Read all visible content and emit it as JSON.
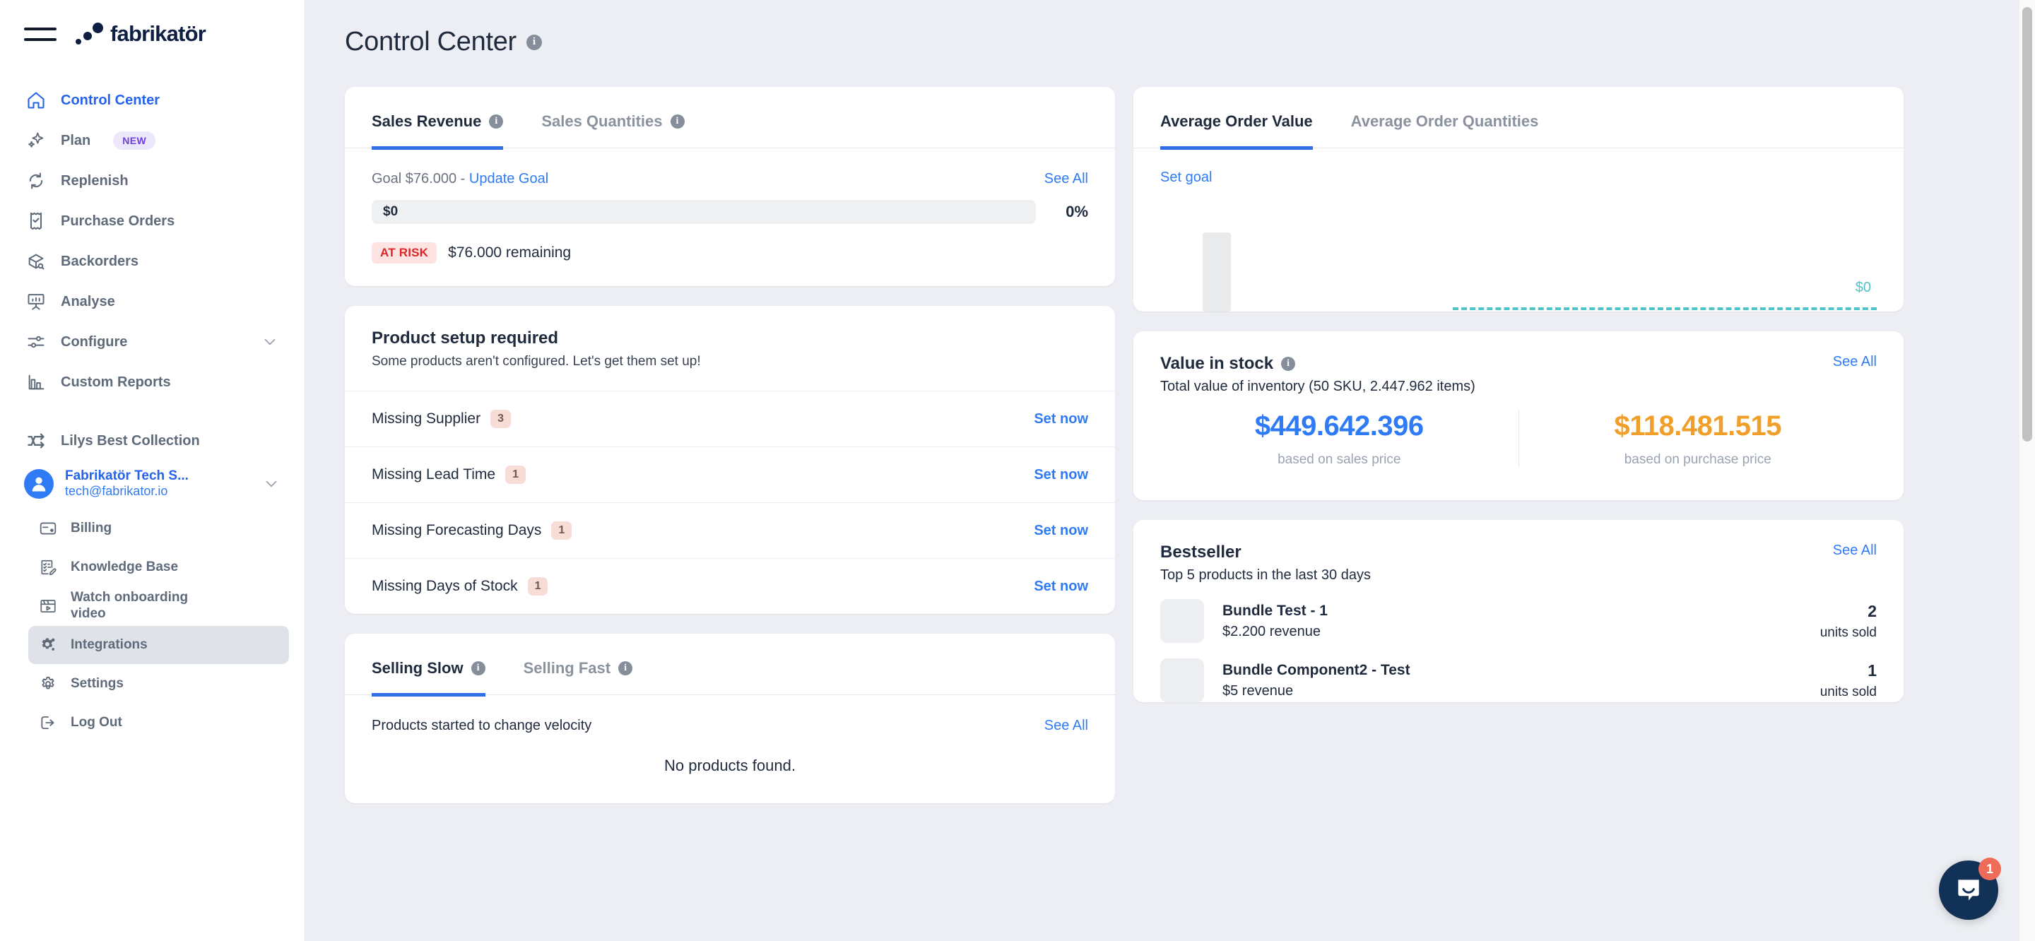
{
  "brand": {
    "name": "fabrikatör"
  },
  "sidebar": {
    "items": [
      {
        "label": "Control Center",
        "icon": "home-icon",
        "state": "active"
      },
      {
        "label": "Plan",
        "icon": "sparkle-icon",
        "badge": "NEW"
      },
      {
        "label": "Replenish",
        "icon": "refresh-icon"
      },
      {
        "label": "Purchase Orders",
        "icon": "receipt-check-icon"
      },
      {
        "label": "Backorders",
        "icon": "box-search-icon"
      },
      {
        "label": "Analyse",
        "icon": "presentation-chart-icon"
      },
      {
        "label": "Configure",
        "icon": "sliders-icon",
        "chevron": true
      },
      {
        "label": "Custom Reports",
        "icon": "bar-chart-icon"
      },
      {
        "label": "Lilys Best Collection",
        "icon": "shuffle-icon"
      }
    ],
    "account": {
      "name": "Fabrikatör Tech S...",
      "email": "tech@fabrikator.io"
    },
    "subitems": [
      {
        "label": "Billing",
        "icon": "credit-card-icon"
      },
      {
        "label": "Knowledge Base",
        "icon": "clipboard-edit-icon"
      },
      {
        "label": "Watch onboarding video",
        "icon": "video-clapper-icon"
      },
      {
        "label": "Integrations",
        "icon": "gears-icon",
        "state": "highlight"
      },
      {
        "label": "Settings",
        "icon": "gear-icon"
      },
      {
        "label": "Log Out",
        "icon": "logout-icon"
      }
    ]
  },
  "page": {
    "title": "Control Center"
  },
  "sales_card": {
    "tabs": [
      {
        "label": "Sales Revenue",
        "active": true,
        "info": true
      },
      {
        "label": "Sales Quantities",
        "active": false,
        "info": true
      }
    ],
    "goal_prefix": "Goal $76.000 - ",
    "goal_link": "Update Goal",
    "see_all": "See All",
    "progress_value": "$0",
    "progress_pct": "0%",
    "risk_badge": "AT RISK",
    "risk_text": "$76.000 remaining"
  },
  "setup_card": {
    "title": "Product setup required",
    "subtitle": "Some products aren't configured. Let's get them set up!",
    "rows": [
      {
        "label": "Missing Supplier",
        "count": "3",
        "action": "Set now"
      },
      {
        "label": "Missing Lead Time",
        "count": "1",
        "action": "Set now"
      },
      {
        "label": "Missing Forecasting Days",
        "count": "1",
        "action": "Set now"
      },
      {
        "label": "Missing Days of Stock",
        "count": "1",
        "action": "Set now"
      }
    ]
  },
  "selling_card": {
    "tabs": [
      {
        "label": "Selling Slow",
        "active": true,
        "info": true
      },
      {
        "label": "Selling Fast",
        "active": false,
        "info": true
      }
    ],
    "velocity_text": "Products started to change velocity",
    "see_all": "See All",
    "empty": "No products found."
  },
  "aov_card": {
    "tabs": [
      {
        "label": "Average Order Value",
        "active": true
      },
      {
        "label": "Average Order Quantities",
        "active": false
      }
    ],
    "set_goal": "Set goal",
    "chart_value": "$0"
  },
  "value_in_stock": {
    "title": "Value in stock",
    "subtitle": "Total value of inventory (50 SKU, 2.447.962 items)",
    "see_all": "See All",
    "stats": [
      {
        "value": "$449.642.396",
        "caption": "based on sales price",
        "color": "#2f7bf6"
      },
      {
        "value": "$118.481.515",
        "caption": "based on purchase price",
        "color": "#f0a02a"
      }
    ]
  },
  "bestseller": {
    "title": "Bestseller",
    "subtitle": "Top 5 products in the last 30 days",
    "see_all": "See All",
    "rows": [
      {
        "name": "Bundle Test - 1",
        "revenue": "$2.200 revenue",
        "units": "2",
        "units_label": "units sold"
      },
      {
        "name": "Bundle Component2 - Test",
        "revenue": "$5 revenue",
        "units": "1",
        "units_label": "units sold"
      }
    ]
  },
  "chat": {
    "unread": "1"
  },
  "chart_data": {
    "type": "bar",
    "title": "Average Order Value",
    "categories": [
      ""
    ],
    "values": [
      0
    ],
    "series": [
      {
        "name": "Average Order Value",
        "values": [
          0
        ]
      }
    ],
    "goal_line": 0,
    "goal_label": "$0",
    "xlabel": "",
    "ylabel": "",
    "ylim": [
      0,
      0
    ],
    "legend": "none",
    "grid": false,
    "annotations": [
      "$0"
    ]
  }
}
